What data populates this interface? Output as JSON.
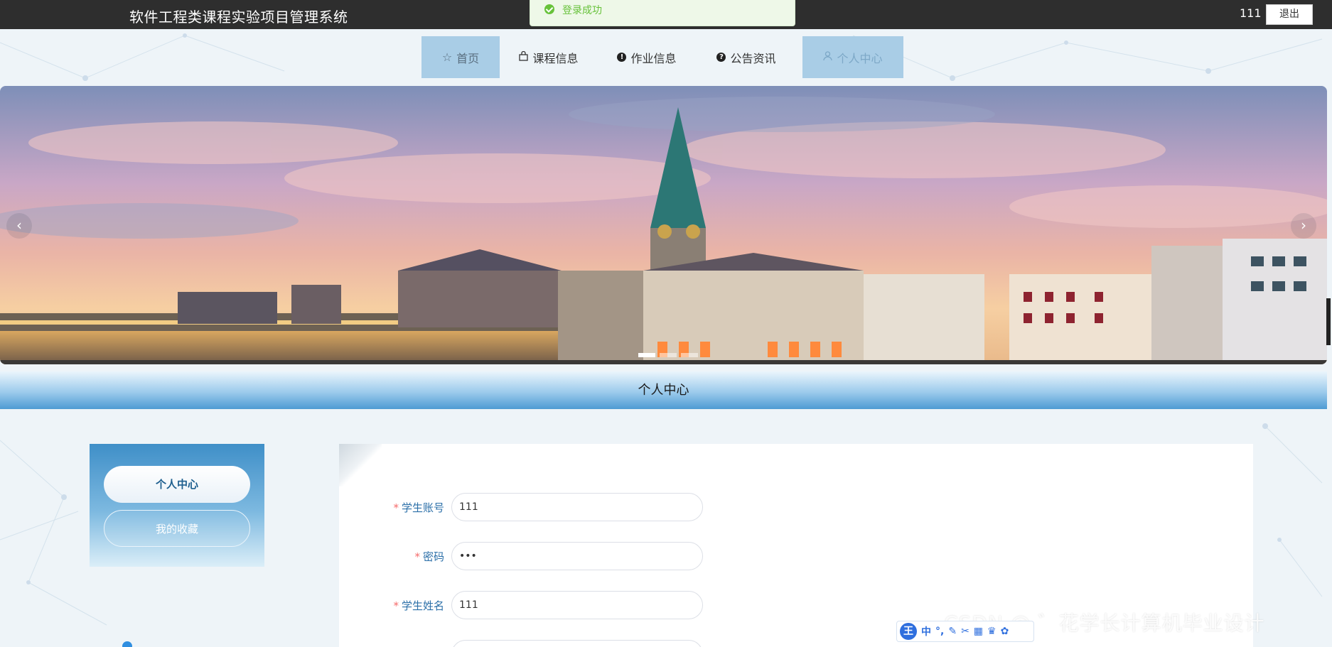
{
  "header": {
    "site_title": "软件工程类课程实验项目管理系统",
    "username": "111",
    "logout_label": "退出"
  },
  "toast": {
    "message": "登录成功"
  },
  "nav": {
    "items": [
      {
        "label": "首页",
        "icon": "star-icon"
      },
      {
        "label": "课程信息",
        "icon": "bag-icon"
      },
      {
        "label": "作业信息",
        "icon": "exclamation-icon"
      },
      {
        "label": "公告资讯",
        "icon": "question-icon"
      },
      {
        "label": "个人中心",
        "icon": "user-icon"
      }
    ]
  },
  "carousel": {
    "slide_count": 3,
    "active_index": 0,
    "prev_glyph": "‹",
    "next_glyph": "›"
  },
  "section": {
    "title": "个人中心"
  },
  "sidebar": {
    "items": [
      {
        "label": "个人中心",
        "active": true
      },
      {
        "label": "我的收藏",
        "active": false
      }
    ]
  },
  "form": {
    "fields": [
      {
        "label": "学生账号",
        "required": true,
        "value": "111"
      },
      {
        "label": "密码",
        "required": true,
        "value": "111"
      },
      {
        "label": "学生姓名",
        "required": true,
        "value": "111"
      },
      {
        "label": "",
        "required": false,
        "value": ""
      }
    ]
  },
  "overlay": {
    "watermark": "CSDN @ ゛花学长计算机毕业设计",
    "ime_logo": "王",
    "ime_items": [
      "中",
      "°,",
      "✎",
      "✂",
      "▦",
      "♛",
      "✿"
    ]
  },
  "colors": {
    "topbar": "#2e2e2e",
    "nav_active": "#a9cde6",
    "accent_blue": "#4e9bd3",
    "label_blue": "#2b6fa8",
    "required_red": "#f56c6c",
    "success_green": "#67c23a"
  }
}
